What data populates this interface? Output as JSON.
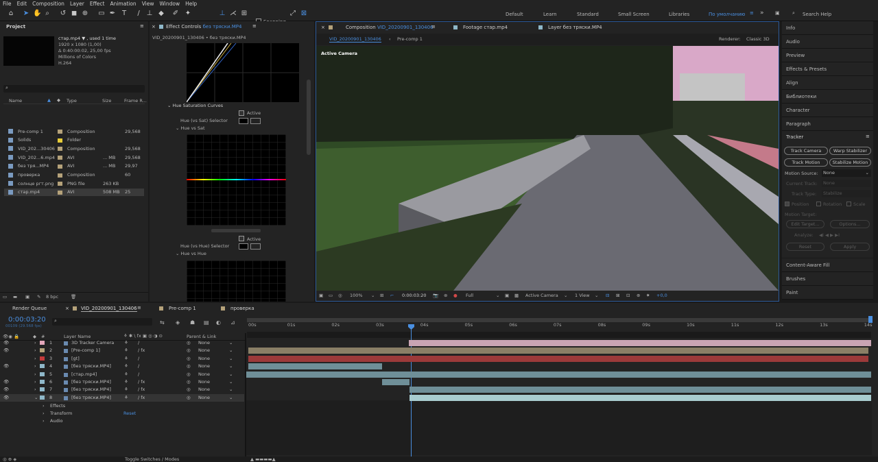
{
  "menu": [
    "File",
    "Edit",
    "Composition",
    "Layer",
    "Effect",
    "Animation",
    "View",
    "Window",
    "Help"
  ],
  "toolbar": {
    "snapping_label": "Snapping",
    "workspaces": [
      "Default",
      "Learn",
      "Standard",
      "Small Screen",
      "Libraries",
      "По умолчанию"
    ],
    "search_placeholder": "Search Help"
  },
  "project": {
    "tab_label": "Project",
    "selected_name": "стар.mp4 ▼ , used 1 time",
    "selected_info": [
      "1920 x 1080 (1,00)",
      "Δ 0:40:00:02, 25,00 fps",
      "Millions of Colors",
      "H.264"
    ],
    "columns": [
      "Name",
      "Type",
      "Size",
      "Frame R..."
    ],
    "items": [
      {
        "name": "Pre-comp 1",
        "type": "Composition",
        "size": "",
        "fps": "29,568",
        "color": "#b5a27a"
      },
      {
        "name": "Solids",
        "type": "Folder",
        "size": "",
        "fps": "",
        "color": "#e7cc38"
      },
      {
        "name": "VID_202...30406",
        "type": "Composition",
        "size": "",
        "fps": "29,568",
        "color": "#b5a27a"
      },
      {
        "name": "VID_202...6.mp4",
        "type": "AVI",
        "size": "... MB",
        "fps": "29,568",
        "color": "#b5a27a"
      },
      {
        "name": "без тря...MP4",
        "type": "AVI",
        "size": "... MB",
        "fps": "29,97",
        "color": "#b5a27a"
      },
      {
        "name": "проверка",
        "type": "Composition",
        "size": "",
        "fps": "60",
        "color": "#b5a27a"
      },
      {
        "name": "солнце ргт.png",
        "type": "PNG file",
        "size": "263 KB",
        "fps": "",
        "color": "#b5a27a"
      },
      {
        "name": "стар.mp4",
        "type": "AVI",
        "size": "508 MB",
        "fps": "25",
        "color": "#b5a27a"
      }
    ],
    "bpc": "8 bpc"
  },
  "effect_controls": {
    "tab_label": "Effect Controls",
    "tab_target": "без тряски.MP4",
    "breadcrumb": "VID_20200901_130406 • без тряски.MP4",
    "section": "Hue Saturation Curves",
    "active_label": "Active",
    "hue_sat_selector": "Hue (vs Sat) Selector",
    "hue_vs_sat": "Hue vs Sat",
    "active_label2": "Active",
    "hue_hue_selector": "Hue (vs Hue) Selector",
    "hue_vs_hue": "Hue vs Hue"
  },
  "composition": {
    "tabs": [
      {
        "label": "Composition",
        "target": "VID_20200901_130406"
      },
      {
        "label": "Footage",
        "target": "стар.mp4"
      },
      {
        "label": "Layer",
        "target": "без тряски.MP4"
      }
    ],
    "crumb1": "VID_20200901_130406",
    "crumb2": "Pre-comp 1",
    "renderer_label": "Renderer:",
    "renderer_value": "Classic 3D",
    "viewer_label": "Active Camera",
    "zoom": "100%",
    "timecode": "0:00:03:20",
    "resolution": "Full",
    "camera": "Active Camera",
    "views": "1 View",
    "exposure": "+0,0"
  },
  "right_panels": [
    "Info",
    "Audio",
    "Preview",
    "Effects & Presets",
    "Align",
    "Библиотеки",
    "Character",
    "Paragraph"
  ],
  "tracker": {
    "title": "Tracker",
    "buttons": [
      "Track Camera",
      "Warp Stabilizer",
      "Track Motion",
      "Stabilize Motion"
    ],
    "motion_source_label": "Motion Source:",
    "motion_source_value": "None",
    "current_track_label": "Current Track:",
    "current_track_value": "None",
    "track_type_label": "Track Type:",
    "track_type_value": "Stabilize",
    "position": "Position",
    "rotation": "Rotation",
    "scale": "Scale",
    "motion_target": "Motion Target:",
    "edit_target": "Edit Target...",
    "options": "Options...",
    "analyze": "Analyze:",
    "reset": "Reset",
    "apply": "Apply"
  },
  "bottom_panels": [
    "Content-Aware Fill",
    "Brushes",
    "Paint"
  ],
  "timeline": {
    "tabs": [
      "Render Queue",
      "VID_20200901_130406",
      "Pre-comp 1",
      "проверка"
    ],
    "timecode": "0:00:03:20",
    "frames": "00109 (29.568 fps)",
    "layer_name_col": "Layer Name",
    "parent_col": "Parent & Link",
    "ruler": [
      "00s",
      "01s",
      "02s",
      "03s",
      "04s",
      "05s",
      "06s",
      "07s",
      "08s",
      "09s",
      "10s",
      "11s",
      "12s",
      "13s",
      "14s"
    ],
    "layers": [
      {
        "num": "1",
        "name": "3D Tracker Camera",
        "color": "#e3a6b9",
        "parent": "None"
      },
      {
        "num": "2",
        "name": "[Pre-comp 1]",
        "color": "#b5a27a",
        "parent": "None"
      },
      {
        "num": "3",
        "name": "[gt]",
        "color": "#c53b3b",
        "parent": "None"
      },
      {
        "num": "4",
        "name": "[без тряски.MP4]",
        "color": "#8fb8c9",
        "parent": "None"
      },
      {
        "num": "5",
        "name": "[стар.mp4]",
        "color": "#8fb8c9",
        "parent": "None"
      },
      {
        "num": "6",
        "name": "[без тряски.MP4]",
        "color": "#8fb8c9",
        "parent": "None"
      },
      {
        "num": "7",
        "name": "[без тряски.MP4]",
        "color": "#8fb8c9",
        "parent": "None"
      },
      {
        "num": "8",
        "name": "[без тряски.MP4]",
        "color": "#8fb8c9",
        "parent": "None"
      }
    ],
    "properties": [
      "Effects",
      "Transform",
      "Audio"
    ],
    "reset_label": "Reset",
    "footer": "Toggle Switches / Modes"
  }
}
